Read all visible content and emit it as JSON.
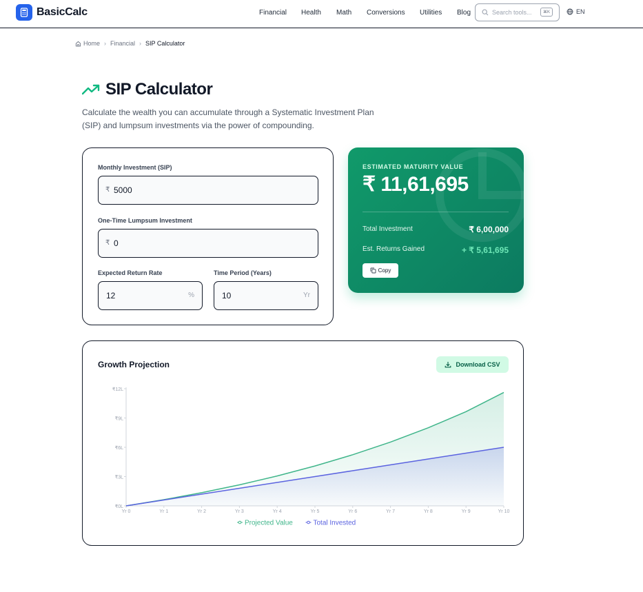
{
  "header": {
    "brand": "BasicCalc",
    "nav": [
      "Financial",
      "Health",
      "Math",
      "Conversions",
      "Utilities",
      "Blog"
    ],
    "search_placeholder": "Search tools...",
    "search_shortcut": "⌘K",
    "language": "EN",
    "brand_color": "#2563eb"
  },
  "breadcrumb": {
    "home": "Home",
    "section": "Financial",
    "current": "SIP Calculator"
  },
  "page": {
    "title": "SIP Calculator",
    "subtitle": "Calculate the wealth you can accumulate through a Systematic Investment Plan (SIP) and lumpsum investments via the power of compounding."
  },
  "form": {
    "monthly_label": "Monthly Investment (SIP)",
    "monthly_prefix": "₹",
    "monthly_value": "5000",
    "lumpsum_label": "One-Time Lumpsum Investment",
    "lumpsum_prefix": "₹",
    "lumpsum_value": "0",
    "rate_label": "Expected Return Rate",
    "rate_value": "12",
    "rate_suffix": "%",
    "period_label": "Time Period (Years)",
    "period_value": "10",
    "period_suffix": "Yr"
  },
  "result": {
    "label": "ESTIMATED MATURITY VALUE",
    "value": "₹ 11,61,695",
    "total_investment_label": "Total Investment",
    "total_investment_value": "₹ 6,00,000",
    "returns_label": "Est. Returns Gained",
    "returns_value": "+ ₹ 5,61,695",
    "copy_label": "Copy",
    "accent_color": "#10b981",
    "returns_color": "#6ee7b7"
  },
  "chart_section": {
    "title": "Growth Projection",
    "download_label": "Download CSV"
  },
  "chart_data": {
    "type": "area",
    "categories": [
      "Yr 0",
      "Yr 1",
      "Yr 2",
      "Yr 3",
      "Yr 4",
      "Yr 5",
      "Yr 6",
      "Yr 7",
      "Yr 8",
      "Yr 9",
      "Yr 10"
    ],
    "series": [
      {
        "name": "Projected Value",
        "color": "#3fb58a",
        "values": [
          0,
          63412,
          134870,
          215393,
          306130,
          408378,
          523597,
          653433,
          799739,
          964605,
          1161695
        ]
      },
      {
        "name": "Total Invested",
        "color": "#5b63e0",
        "values": [
          0,
          60000,
          120000,
          180000,
          240000,
          300000,
          360000,
          420000,
          480000,
          540000,
          600000
        ]
      }
    ],
    "y_ticks": [
      "₹0L",
      "₹3L",
      "₹6L",
      "₹9L",
      "₹12L"
    ],
    "y_tick_values": [
      0,
      300000,
      600000,
      900000,
      1200000
    ],
    "ylim": [
      0,
      1200000
    ],
    "legend_position": "bottom",
    "grid": false
  }
}
